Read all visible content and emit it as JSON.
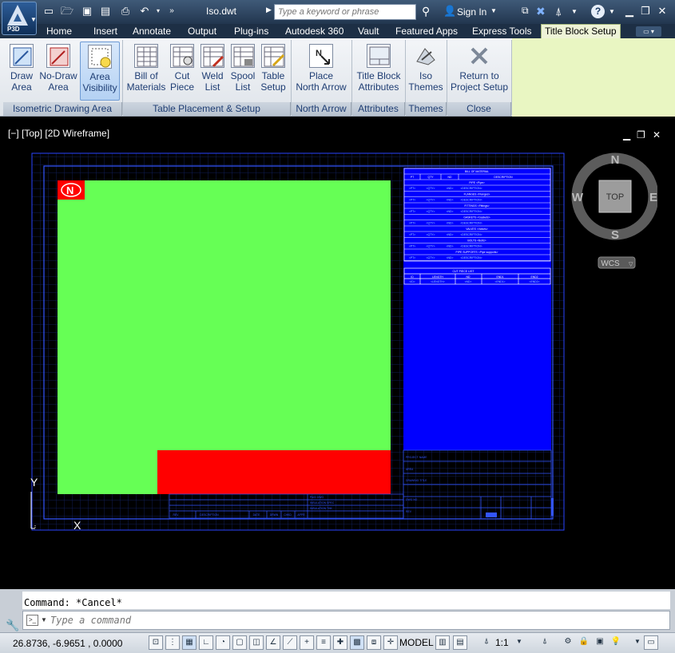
{
  "app": {
    "badge": "P3D",
    "document_title": "Iso.dwt",
    "search_placeholder": "Type a keyword or phrase",
    "sign_in": "Sign In"
  },
  "ribbon_tabs": [
    "Home",
    "Insert",
    "Annotate",
    "Output",
    "Plug-ins",
    "Autodesk 360",
    "Vault",
    "Featured Apps",
    "Express Tools",
    "Title Block Setup"
  ],
  "active_tab": "Title Block Setup",
  "ribbon_buttons": [
    {
      "line1": "Draw",
      "line2": "Area",
      "icon": "draw-area-icon"
    },
    {
      "line1": "No-Draw",
      "line2": "Area",
      "icon": "no-draw-area-icon"
    },
    {
      "line1": "Area",
      "line2": "Visibility",
      "icon": "area-visibility-icon",
      "selected": true
    },
    {
      "line1": "Bill of",
      "line2": "Materials",
      "icon": "bill-of-materials-icon"
    },
    {
      "line1": "Cut",
      "line2": "Piece",
      "icon": "cut-piece-icon"
    },
    {
      "line1": "Weld",
      "line2": "List",
      "icon": "weld-list-icon"
    },
    {
      "line1": "Spool",
      "line2": "List",
      "icon": "spool-list-icon"
    },
    {
      "line1": "Table",
      "line2": "Setup",
      "icon": "table-setup-icon"
    },
    {
      "line1": "Place",
      "line2": "North Arrow",
      "icon": "north-arrow-icon"
    },
    {
      "line1": "Title Block",
      "line2": "Attributes",
      "icon": "title-block-attributes-icon"
    },
    {
      "line1": "Iso",
      "line2": "Themes",
      "icon": "iso-themes-icon"
    },
    {
      "line1": "Return to",
      "line2": "Project Setup",
      "icon": "close-x-icon"
    }
  ],
  "ribbon_groups": [
    "Isometric Drawing Area",
    "Table Placement & Setup",
    "North Arrow",
    "Attributes",
    "Themes",
    "Close"
  ],
  "viewport": {
    "label": "[−] [Top] [2D Wireframe]",
    "viewcube": {
      "top_face": "TOP",
      "north": "N",
      "south": "S",
      "east": "E",
      "west": "W",
      "ucs": "WCS"
    },
    "axis_y": "Y",
    "axis_x": "X"
  },
  "drawing": {
    "colors": {
      "iso_area": "#66ff55",
      "no_draw_area": "#ff0000",
      "table_area": "#0000ff",
      "frame": "#3355ff"
    },
    "bom_title": "BILL OF MATERIAL",
    "bom_headers": [
      "PT",
      "QTY",
      "ND",
      "DESCRIPTION"
    ],
    "bom_sections": [
      "PIPE <Pipe>",
      "FLANGES <Flanges>",
      "FITTINGS <Fittings>",
      "GASKETS <Gaskets>",
      "VALVES <Valves>",
      "BOLTS <Bolts>",
      "PIPE SUPPORTS <Pipe supports>"
    ],
    "bom_cells": [
      "<PT>",
      "<QTY>",
      "<ND>",
      "<DESCRIPTION>"
    ],
    "cut_title": "CUT PIECE LIST",
    "cut_headers": [
      "ID",
      "LENGTH",
      "ND",
      "END1",
      "END2"
    ],
    "cut_cells": [
      "<ID>",
      "<LENGTH>",
      "<ND>",
      "<END1>",
      "<END2>"
    ],
    "titleblock_labels": [
      "PROJECT NAME",
      "AREA",
      "DRAWING TITLE",
      "DWG NO",
      "REV"
    ],
    "rev_block_rows": [
      "P&ID DWG",
      "INSULATION SPEC",
      "INSULATION THK"
    ],
    "rev_block_headers": [
      "REV",
      "DESCRIPTION",
      "DATE",
      "DRWN",
      "CHKD",
      "APPR"
    ]
  },
  "command": {
    "history": "Command: *Cancel*",
    "placeholder": "Type a command"
  },
  "status": {
    "coords": "26.8736, -6.9651 , 0.0000",
    "model": "MODEL",
    "scale": "1:1"
  }
}
